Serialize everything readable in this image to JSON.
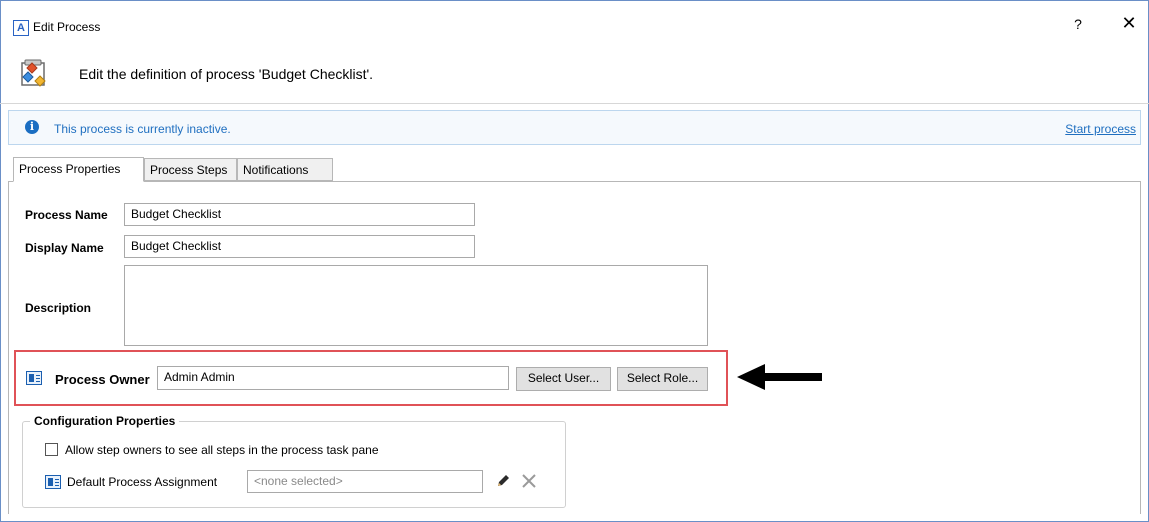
{
  "window": {
    "title": "Edit Process",
    "app_icon_letter": "A",
    "help": "?",
    "close": "✕"
  },
  "header": {
    "text": "Edit the definition of process 'Budget Checklist'."
  },
  "info_bar": {
    "message": "This process is currently inactive.",
    "action_link": "Start process",
    "icon_glyph": "i"
  },
  "tabs": [
    {
      "label": "Process Properties",
      "active": true
    },
    {
      "label": "Process Steps",
      "active": false
    },
    {
      "label": "Notifications",
      "active": false
    }
  ],
  "form": {
    "process_name_label": "Process Name",
    "process_name_value": "Budget Checklist",
    "display_name_label": "Display Name",
    "display_name_value": "Budget Checklist",
    "description_label": "Description",
    "description_value": "",
    "process_owner_label": "Process Owner",
    "process_owner_value": "Admin Admin",
    "select_user_button": "Select User...",
    "select_role_button": "Select Role..."
  },
  "config": {
    "title": "Configuration Properties",
    "allow_step_owners_label": "Allow step owners to see all steps in the process task pane",
    "allow_step_owners_checked": false,
    "default_assignment_label": "Default Process Assignment",
    "default_assignment_value": "<none selected>"
  },
  "colors": {
    "highlight_border": "#e05257",
    "link": "#1f6fc0",
    "info_bg": "#f5f9fd"
  }
}
